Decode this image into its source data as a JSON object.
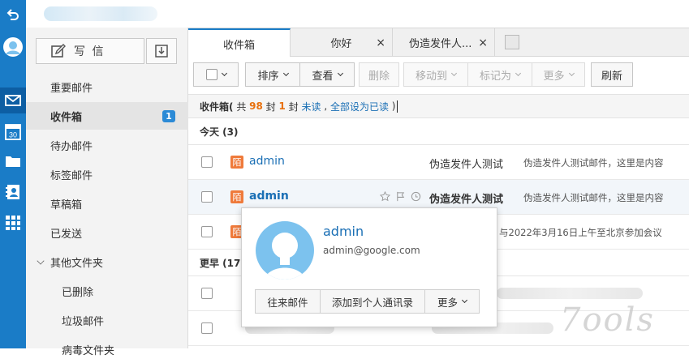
{
  "rail": {
    "icons": [
      "back-icon",
      "user-avatar-icon",
      "mail-icon",
      "calendar-icon",
      "folder-icon",
      "contacts-icon",
      "apps-grid-icon"
    ],
    "calendar_day": "30"
  },
  "sidebar": {
    "compose_label": "写 信",
    "folders": [
      {
        "label": "重要邮件"
      },
      {
        "label": "收件箱",
        "badge": "1"
      },
      {
        "label": "待办邮件"
      },
      {
        "label": "标签邮件"
      },
      {
        "label": "草稿箱"
      },
      {
        "label": "已发送"
      },
      {
        "label": "其他文件夹"
      },
      {
        "label": "已删除"
      },
      {
        "label": "垃圾邮件"
      },
      {
        "label": "病毒文件夹"
      }
    ]
  },
  "tabs": [
    {
      "label": "收件箱"
    },
    {
      "label": "你好",
      "close": "×"
    },
    {
      "label": "伪造发件人...",
      "close": "×"
    }
  ],
  "toolbar": {
    "sort": "排序",
    "view": "查看",
    "delete": "删除",
    "move_to": "移动到",
    "mark_as": "标记为",
    "more": "更多",
    "refresh": "刷新"
  },
  "summary": {
    "prefix": "收件箱(",
    "total_pre": " 共 ",
    "total": "98",
    "total_unit": " 封 ",
    "unread": "1",
    "unread_unit": " 封 ",
    "unread_link": "未读",
    "sep": " , ",
    "mark_all_link": "全部设为已读",
    "suffix": " )"
  },
  "groups": {
    "today": "今天 (3)",
    "earlier": "更早 (17)"
  },
  "messages": [
    {
      "tag": "陌",
      "sender": "admin",
      "subject": "伪造发件人测试",
      "preview": "伪造发件人测试邮件，这里是内容"
    },
    {
      "tag": "陌",
      "sender": "admin",
      "subject": "伪造发件人测试",
      "preview": "伪造发件人测试邮件，这里是内容"
    },
    {
      "tag": "陌",
      "preview": "与2022年3月16日上午至北京参加会议"
    }
  ],
  "popup": {
    "name": "admin",
    "email": "admin@google.com",
    "actions": [
      "往来邮件",
      "添加到个人通讯录",
      "更多"
    ]
  },
  "watermark": "7ools",
  "colors": {
    "rail": "#1a7cc7",
    "accent": "#1a6fb5",
    "orange": "#e8700c",
    "tag": "#ef7a3b",
    "avatar": "#7cc2ee"
  }
}
